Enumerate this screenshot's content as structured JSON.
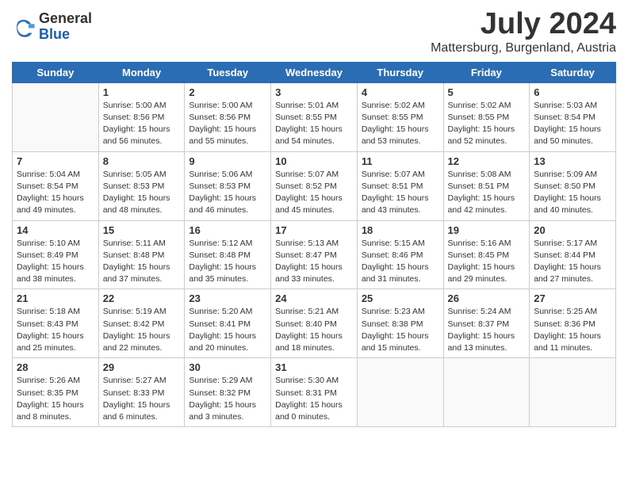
{
  "logo": {
    "general": "General",
    "blue": "Blue"
  },
  "title": "July 2024",
  "location": "Mattersburg, Burgenland, Austria",
  "weekdays": [
    "Sunday",
    "Monday",
    "Tuesday",
    "Wednesday",
    "Thursday",
    "Friday",
    "Saturday"
  ],
  "weeks": [
    [
      {
        "day": "",
        "info": ""
      },
      {
        "day": "1",
        "info": "Sunrise: 5:00 AM\nSunset: 8:56 PM\nDaylight: 15 hours\nand 56 minutes."
      },
      {
        "day": "2",
        "info": "Sunrise: 5:00 AM\nSunset: 8:56 PM\nDaylight: 15 hours\nand 55 minutes."
      },
      {
        "day": "3",
        "info": "Sunrise: 5:01 AM\nSunset: 8:55 PM\nDaylight: 15 hours\nand 54 minutes."
      },
      {
        "day": "4",
        "info": "Sunrise: 5:02 AM\nSunset: 8:55 PM\nDaylight: 15 hours\nand 53 minutes."
      },
      {
        "day": "5",
        "info": "Sunrise: 5:02 AM\nSunset: 8:55 PM\nDaylight: 15 hours\nand 52 minutes."
      },
      {
        "day": "6",
        "info": "Sunrise: 5:03 AM\nSunset: 8:54 PM\nDaylight: 15 hours\nand 50 minutes."
      }
    ],
    [
      {
        "day": "7",
        "info": "Sunrise: 5:04 AM\nSunset: 8:54 PM\nDaylight: 15 hours\nand 49 minutes."
      },
      {
        "day": "8",
        "info": "Sunrise: 5:05 AM\nSunset: 8:53 PM\nDaylight: 15 hours\nand 48 minutes."
      },
      {
        "day": "9",
        "info": "Sunrise: 5:06 AM\nSunset: 8:53 PM\nDaylight: 15 hours\nand 46 minutes."
      },
      {
        "day": "10",
        "info": "Sunrise: 5:07 AM\nSunset: 8:52 PM\nDaylight: 15 hours\nand 45 minutes."
      },
      {
        "day": "11",
        "info": "Sunrise: 5:07 AM\nSunset: 8:51 PM\nDaylight: 15 hours\nand 43 minutes."
      },
      {
        "day": "12",
        "info": "Sunrise: 5:08 AM\nSunset: 8:51 PM\nDaylight: 15 hours\nand 42 minutes."
      },
      {
        "day": "13",
        "info": "Sunrise: 5:09 AM\nSunset: 8:50 PM\nDaylight: 15 hours\nand 40 minutes."
      }
    ],
    [
      {
        "day": "14",
        "info": "Sunrise: 5:10 AM\nSunset: 8:49 PM\nDaylight: 15 hours\nand 38 minutes."
      },
      {
        "day": "15",
        "info": "Sunrise: 5:11 AM\nSunset: 8:48 PM\nDaylight: 15 hours\nand 37 minutes."
      },
      {
        "day": "16",
        "info": "Sunrise: 5:12 AM\nSunset: 8:48 PM\nDaylight: 15 hours\nand 35 minutes."
      },
      {
        "day": "17",
        "info": "Sunrise: 5:13 AM\nSunset: 8:47 PM\nDaylight: 15 hours\nand 33 minutes."
      },
      {
        "day": "18",
        "info": "Sunrise: 5:15 AM\nSunset: 8:46 PM\nDaylight: 15 hours\nand 31 minutes."
      },
      {
        "day": "19",
        "info": "Sunrise: 5:16 AM\nSunset: 8:45 PM\nDaylight: 15 hours\nand 29 minutes."
      },
      {
        "day": "20",
        "info": "Sunrise: 5:17 AM\nSunset: 8:44 PM\nDaylight: 15 hours\nand 27 minutes."
      }
    ],
    [
      {
        "day": "21",
        "info": "Sunrise: 5:18 AM\nSunset: 8:43 PM\nDaylight: 15 hours\nand 25 minutes."
      },
      {
        "day": "22",
        "info": "Sunrise: 5:19 AM\nSunset: 8:42 PM\nDaylight: 15 hours\nand 22 minutes."
      },
      {
        "day": "23",
        "info": "Sunrise: 5:20 AM\nSunset: 8:41 PM\nDaylight: 15 hours\nand 20 minutes."
      },
      {
        "day": "24",
        "info": "Sunrise: 5:21 AM\nSunset: 8:40 PM\nDaylight: 15 hours\nand 18 minutes."
      },
      {
        "day": "25",
        "info": "Sunrise: 5:23 AM\nSunset: 8:38 PM\nDaylight: 15 hours\nand 15 minutes."
      },
      {
        "day": "26",
        "info": "Sunrise: 5:24 AM\nSunset: 8:37 PM\nDaylight: 15 hours\nand 13 minutes."
      },
      {
        "day": "27",
        "info": "Sunrise: 5:25 AM\nSunset: 8:36 PM\nDaylight: 15 hours\nand 11 minutes."
      }
    ],
    [
      {
        "day": "28",
        "info": "Sunrise: 5:26 AM\nSunset: 8:35 PM\nDaylight: 15 hours\nand 8 minutes."
      },
      {
        "day": "29",
        "info": "Sunrise: 5:27 AM\nSunset: 8:33 PM\nDaylight: 15 hours\nand 6 minutes."
      },
      {
        "day": "30",
        "info": "Sunrise: 5:29 AM\nSunset: 8:32 PM\nDaylight: 15 hours\nand 3 minutes."
      },
      {
        "day": "31",
        "info": "Sunrise: 5:30 AM\nSunset: 8:31 PM\nDaylight: 15 hours\nand 0 minutes."
      },
      {
        "day": "",
        "info": ""
      },
      {
        "day": "",
        "info": ""
      },
      {
        "day": "",
        "info": ""
      }
    ]
  ]
}
